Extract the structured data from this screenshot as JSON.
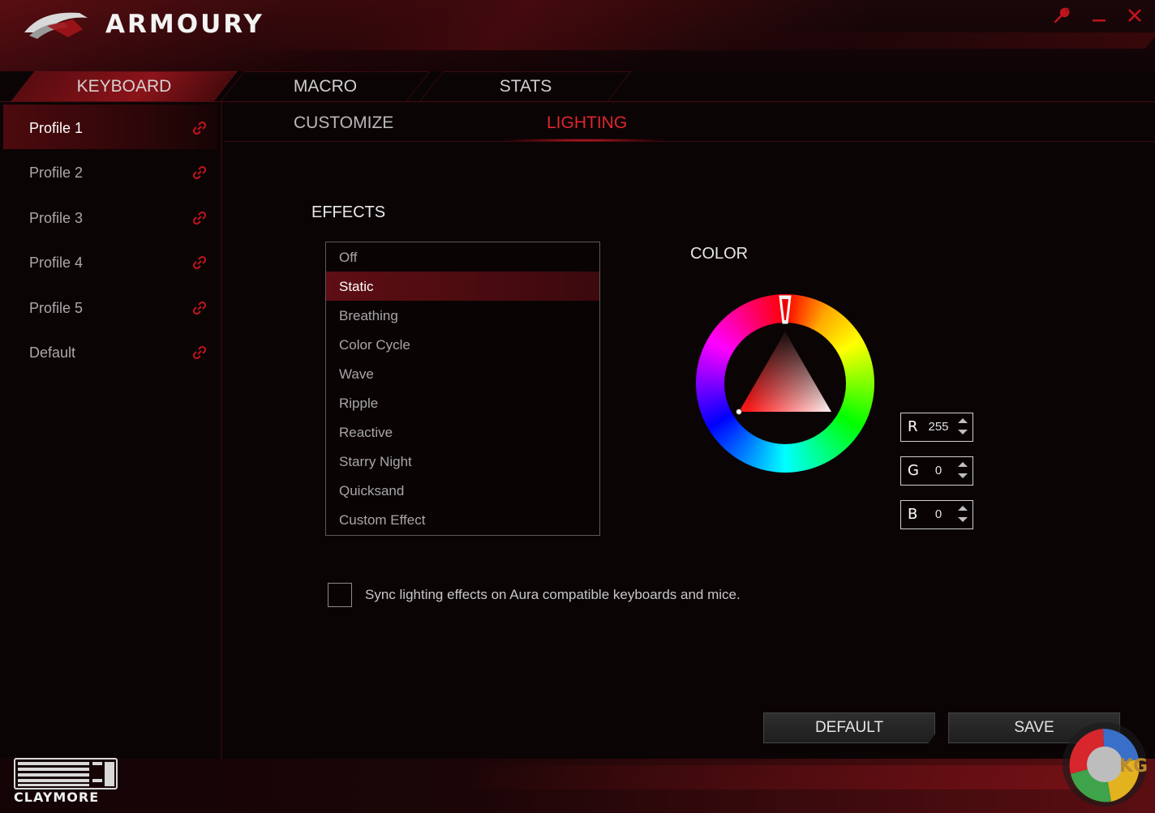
{
  "app": {
    "title": "ARMOURY"
  },
  "window": {
    "settings_icon": "wrench-icon",
    "minimize_icon": "minimize-icon",
    "close_icon": "close-icon"
  },
  "top_tabs": [
    {
      "label": "KEYBOARD",
      "active": true
    },
    {
      "label": "MACRO",
      "active": false
    },
    {
      "label": "STATS",
      "active": false
    }
  ],
  "sidebar": {
    "profiles": [
      {
        "label": "Profile 1",
        "active": true,
        "icon": "link-icon"
      },
      {
        "label": "Profile 2",
        "active": false,
        "icon": "link-icon"
      },
      {
        "label": "Profile 3",
        "active": false,
        "icon": "link-icon"
      },
      {
        "label": "Profile 4",
        "active": false,
        "icon": "link-icon"
      },
      {
        "label": "Profile 5",
        "active": false,
        "icon": "link-icon"
      },
      {
        "label": "Default",
        "active": false,
        "icon": "link-icon"
      }
    ]
  },
  "sub_tabs": [
    {
      "label": "CUSTOMIZE",
      "active": false
    },
    {
      "label": "LIGHTING",
      "active": true
    }
  ],
  "effects": {
    "heading": "EFFECTS",
    "selected": "Static",
    "items": [
      "Off",
      "Static",
      "Breathing",
      "Color Cycle",
      "Wave",
      "Ripple",
      "Reactive",
      "Starry Night",
      "Quicksand",
      "Custom Effect"
    ]
  },
  "color": {
    "heading": "COLOR",
    "r_label": "R",
    "r_value": "255",
    "g_label": "G",
    "g_value": "0",
    "b_label": "B",
    "b_value": "0",
    "selected_hex": "#ff0000"
  },
  "sync": {
    "label": "Sync lighting effects on Aura compatible keyboards and mice.",
    "checked": false
  },
  "buttons": {
    "default_label": "DEFAULT",
    "save_label": "SAVE"
  },
  "device": {
    "name": "CLAYMORE"
  },
  "watermark": {
    "text": "KG"
  },
  "colors": {
    "accent": "#e0262e",
    "active_tab": "#8b141a",
    "background": "#0b0405"
  }
}
